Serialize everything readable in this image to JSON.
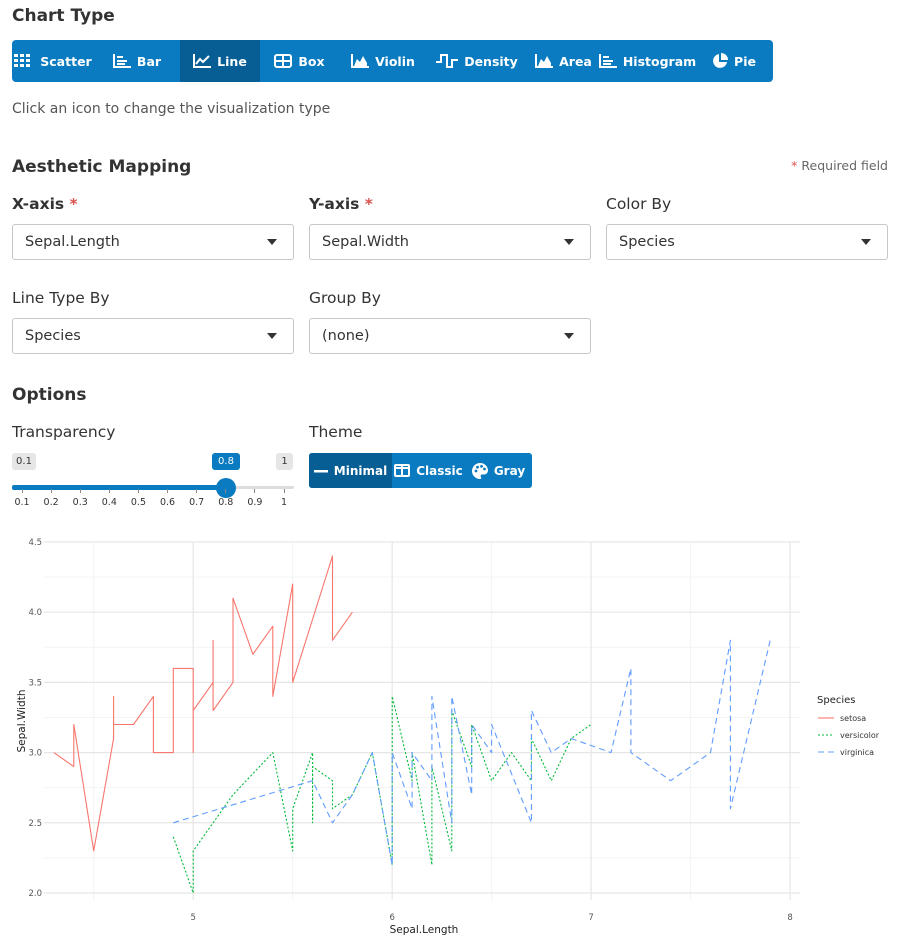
{
  "chart_type": {
    "heading": "Chart Type",
    "buttons": [
      {
        "label": "Scatter",
        "icon": "scatter-icon"
      },
      {
        "label": "Bar",
        "icon": "bar-icon"
      },
      {
        "label": "Line",
        "icon": "line-chart-icon",
        "active": true
      },
      {
        "label": "Box",
        "icon": "box-icon"
      },
      {
        "label": "Violin",
        "icon": "violin-icon"
      },
      {
        "label": "Density",
        "icon": "density-icon"
      },
      {
        "label": "Area",
        "icon": "area-icon"
      },
      {
        "label": "Histogram",
        "icon": "histogram-icon"
      },
      {
        "label": "Pie",
        "icon": "pie-icon"
      }
    ],
    "help": "Click an icon to change the visualization type"
  },
  "aesthetic": {
    "heading": "Aesthetic Mapping",
    "required_note_star": "*",
    "required_note": "Required field",
    "x_label": "X-axis",
    "y_label": "Y-axis",
    "color_label": "Color By",
    "linetype_label": "Line Type By",
    "group_label": "Group By",
    "x_value": "Sepal.Length",
    "y_value": "Sepal.Width",
    "color_value": "Species",
    "linetype_value": "Species",
    "group_value": "(none)"
  },
  "options": {
    "heading": "Options",
    "transparency_label": "Transparency",
    "slider": {
      "min": "0.1",
      "max": "1",
      "value": "0.8",
      "value_num": 0.8,
      "ticks": [
        "0.1",
        "0.2",
        "0.3",
        "0.4",
        "0.5",
        "0.6",
        "0.7",
        "0.8",
        "0.9",
        "1"
      ]
    },
    "theme_label": "Theme",
    "themes": [
      {
        "label": "Minimal",
        "icon": "minus-icon",
        "active": true
      },
      {
        "label": "Classic",
        "icon": "columns-icon"
      },
      {
        "label": "Gray",
        "icon": "palette-icon"
      }
    ]
  },
  "colors": {
    "accent": "#0a7bc0",
    "accent_dark": "#075e94",
    "setosa": "#F8766D",
    "versicolor": "#00BA38",
    "virginica": "#619CFF"
  },
  "chart_data": {
    "type": "line",
    "xlabel": "Sepal.Length",
    "ylabel": "Sepal.Width",
    "xlim": [
      4.25,
      8.05
    ],
    "ylim": [
      1.95,
      4.5
    ],
    "xticks": [
      "5",
      "6",
      "7",
      "8"
    ],
    "yticks": [
      "2.0",
      "2.5",
      "3.0",
      "3.5",
      "4.0",
      "4.5"
    ],
    "legend_title": "Species",
    "legend_position": "right",
    "series": [
      {
        "name": "setosa",
        "dash": "",
        "points": [
          [
            4.3,
            3.0
          ],
          [
            4.4,
            2.9
          ],
          [
            4.4,
            3.2
          ],
          [
            4.5,
            2.3
          ],
          [
            4.6,
            3.1
          ],
          [
            4.6,
            3.4
          ],
          [
            4.6,
            3.2
          ],
          [
            4.7,
            3.2
          ],
          [
            4.7,
            3.2
          ],
          [
            4.8,
            3.4
          ],
          [
            4.8,
            3.0
          ],
          [
            4.9,
            3.0
          ],
          [
            4.9,
            3.1
          ],
          [
            4.9,
            3.6
          ],
          [
            5.0,
            3.6
          ],
          [
            5.0,
            3.0
          ],
          [
            5.0,
            3.3
          ],
          [
            5.1,
            3.5
          ],
          [
            5.1,
            3.8
          ],
          [
            5.1,
            3.3
          ],
          [
            5.2,
            3.5
          ],
          [
            5.2,
            4.1
          ],
          [
            5.3,
            3.7
          ],
          [
            5.4,
            3.9
          ],
          [
            5.4,
            3.4
          ],
          [
            5.5,
            4.2
          ],
          [
            5.5,
            3.5
          ],
          [
            5.7,
            4.4
          ],
          [
            5.7,
            3.8
          ],
          [
            5.8,
            4.0
          ]
        ]
      },
      {
        "name": "versicolor",
        "dash": "2,2",
        "points": [
          [
            4.9,
            2.4
          ],
          [
            5.0,
            2.0
          ],
          [
            5.0,
            2.3
          ],
          [
            5.2,
            2.7
          ],
          [
            5.4,
            3.0
          ],
          [
            5.5,
            2.3
          ],
          [
            5.5,
            2.6
          ],
          [
            5.6,
            3.0
          ],
          [
            5.6,
            2.5
          ],
          [
            5.6,
            2.9
          ],
          [
            5.7,
            2.8
          ],
          [
            5.7,
            2.6
          ],
          [
            5.8,
            2.7
          ],
          [
            5.9,
            3.0
          ],
          [
            6.0,
            2.2
          ],
          [
            6.0,
            3.4
          ],
          [
            6.1,
            2.8
          ],
          [
            6.1,
            3.0
          ],
          [
            6.2,
            2.2
          ],
          [
            6.2,
            2.9
          ],
          [
            6.3,
            2.3
          ],
          [
            6.3,
            3.3
          ],
          [
            6.4,
            2.9
          ],
          [
            6.4,
            3.2
          ],
          [
            6.5,
            2.8
          ],
          [
            6.6,
            3.0
          ],
          [
            6.7,
            2.8
          ],
          [
            6.7,
            3.1
          ],
          [
            6.8,
            2.8
          ],
          [
            6.9,
            3.1
          ],
          [
            7.0,
            3.2
          ]
        ]
      },
      {
        "name": "virginica",
        "dash": "6,4",
        "points": [
          [
            4.9,
            2.5
          ],
          [
            5.6,
            2.8
          ],
          [
            5.7,
            2.5
          ],
          [
            5.8,
            2.7
          ],
          [
            5.9,
            3.0
          ],
          [
            6.0,
            2.2
          ],
          [
            6.0,
            3.0
          ],
          [
            6.1,
            2.6
          ],
          [
            6.1,
            3.0
          ],
          [
            6.2,
            2.8
          ],
          [
            6.2,
            3.4
          ],
          [
            6.3,
            2.5
          ],
          [
            6.3,
            3.4
          ],
          [
            6.4,
            2.7
          ],
          [
            6.4,
            3.2
          ],
          [
            6.5,
            3.0
          ],
          [
            6.5,
            3.2
          ],
          [
            6.7,
            2.5
          ],
          [
            6.7,
            3.3
          ],
          [
            6.8,
            3.0
          ],
          [
            6.9,
            3.1
          ],
          [
            7.1,
            3.0
          ],
          [
            7.2,
            3.6
          ],
          [
            7.2,
            3.0
          ],
          [
            7.4,
            2.8
          ],
          [
            7.6,
            3.0
          ],
          [
            7.7,
            3.8
          ],
          [
            7.7,
            2.6
          ],
          [
            7.9,
            3.8
          ]
        ]
      }
    ]
  }
}
